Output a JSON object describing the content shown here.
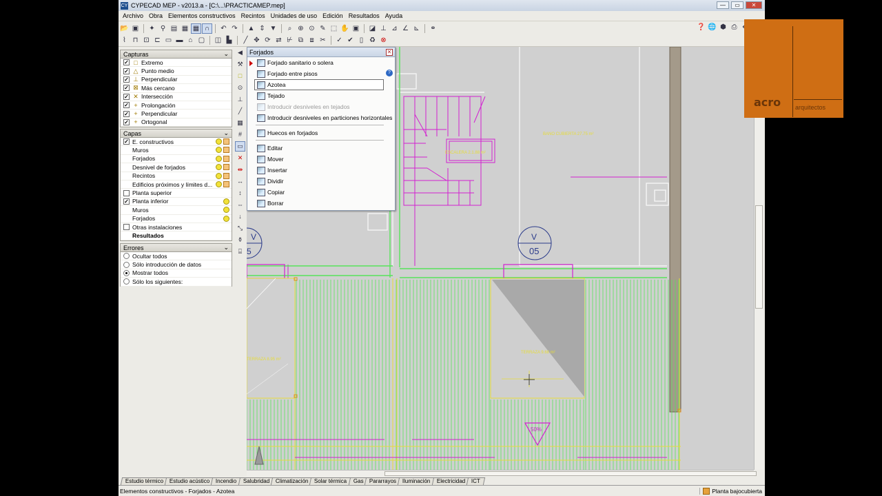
{
  "window": {
    "title": "CYPECAD MEP - v2013.a - [C:\\...\\PRACTICAMEP.mep]",
    "app_icon": "CY",
    "minimize": "—",
    "maximize": "▭",
    "close": "✕"
  },
  "menu": [
    "Archivo",
    "Obra",
    "Elementos constructivos",
    "Recintos",
    "Unidades de uso",
    "Edición",
    "Resultados",
    "Ayuda"
  ],
  "capturas": {
    "title": "Capturas",
    "items": [
      {
        "label": "Extremo",
        "checked": true,
        "symbol": "□"
      },
      {
        "label": "Punto medio",
        "checked": true,
        "symbol": "△"
      },
      {
        "label": "Perpendicular",
        "checked": true,
        "symbol": "⊥"
      },
      {
        "label": "Más cercano",
        "checked": true,
        "symbol": "⊠"
      },
      {
        "label": "Intersección",
        "checked": true,
        "symbol": "✕"
      },
      {
        "label": "Prolongación",
        "checked": true,
        "symbol": "+"
      },
      {
        "label": "Perpendicular",
        "checked": true,
        "symbol": "+"
      },
      {
        "label": "Ortogonal",
        "checked": true,
        "symbol": "+"
      }
    ]
  },
  "capas": {
    "title": "Capas",
    "items": [
      {
        "label": "E. constructivos",
        "checked": true,
        "indent": false,
        "bold": false
      },
      {
        "label": "Muros",
        "indent": true
      },
      {
        "label": "Forjados",
        "indent": true
      },
      {
        "label": "Desnivel de forjados",
        "indent": true
      },
      {
        "label": "Recintos",
        "indent": true
      },
      {
        "label": "Edificios próximos y límites d...",
        "indent": true
      },
      {
        "label": "Planta superior",
        "checked": false
      },
      {
        "label": "Planta inferior",
        "checked": true
      },
      {
        "label": "Muros",
        "indent": true
      },
      {
        "label": "Forjados",
        "indent": true
      },
      {
        "label": "Otras instalaciones",
        "checked": false
      },
      {
        "label": "Resultados",
        "indent": true,
        "bold": true
      }
    ]
  },
  "errores": {
    "title": "Errores",
    "options": [
      {
        "label": "Ocultar todos",
        "selected": false
      },
      {
        "label": "Sólo introducción de datos",
        "selected": false
      },
      {
        "label": "Mostrar todos",
        "selected": true
      },
      {
        "label": "Sólo los siguientes:",
        "selected": false
      }
    ]
  },
  "forjados_menu": {
    "title": "Forjados",
    "items": [
      {
        "label": "Forjado sanitario o solera"
      },
      {
        "label": "Forjado entre pisos"
      },
      {
        "label": "Azotea",
        "highlighted": true
      },
      {
        "label": "Tejado"
      },
      {
        "label": "Introducir desniveles en tejados",
        "disabled": true
      },
      {
        "label": "Introducir desniveles en particiones horizontales"
      },
      {
        "separator": true
      },
      {
        "label": "Huecos en forjados"
      },
      {
        "separator": true
      },
      {
        "label": "Editar"
      },
      {
        "label": "Mover"
      },
      {
        "label": "Insertar"
      },
      {
        "label": "Dividir"
      },
      {
        "label": "Copiar"
      },
      {
        "label": "Borrar"
      }
    ]
  },
  "drawing": {
    "v_marker": {
      "letter": "V",
      "number": "05"
    },
    "v_marker_left": {
      "letter": "V",
      "number": "5"
    },
    "slope": "50%",
    "labels": [
      "ESCALERA 2.1.88 m²",
      "BANO CUBIERTA 27.75 m²",
      "TERRAZA 9.68 m²",
      "TERRAZA 8.95 m²"
    ],
    "colors": {
      "magenta": "#d21fd0",
      "green": "#57e35a",
      "yellow": "#e6dc3a",
      "bg": "#d0d0d0"
    }
  },
  "tabs": [
    "Estudio térmico",
    "Estudio acústico",
    "Incendio",
    "Salubridad",
    "Climatización",
    "Solar térmica",
    "Gas",
    "Pararrayos",
    "Iluminación",
    "Electricidad",
    "ICT"
  ],
  "status": {
    "text": "Elementos constructivos - Forjados - Azotea",
    "floor": "Planta bajocubierta"
  },
  "logo": {
    "brand": "acro",
    "sub": "arquitectos",
    "color": "#cf6e14"
  }
}
